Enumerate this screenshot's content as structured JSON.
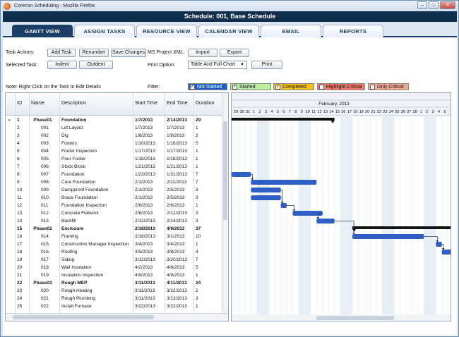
{
  "window": {
    "title": "Corecon Scheduling - Mozilla Firefox"
  },
  "header": {
    "title": "Schedule: 001, Base Schedule"
  },
  "tabs": [
    {
      "label": "Gantt View",
      "active": true
    },
    {
      "label": "Assign Tasks",
      "active": false
    },
    {
      "label": "Resource View",
      "active": false
    },
    {
      "label": "Calendar View",
      "active": false
    },
    {
      "label": "Email",
      "active": false
    },
    {
      "label": "Reports",
      "active": false
    }
  ],
  "controls": {
    "task_actions_label": "Task Actions:",
    "add_task": "Add Task",
    "renumber": "Renumber",
    "save_changes": "Save Changes",
    "ms_project_label": "MS Project XML:",
    "import": "Import",
    "export": "Export",
    "selected_task_label": "Selected Task:",
    "indent": "Indent",
    "outdent": "Outdent",
    "print_option_label": "Print Option:",
    "print_option_value": "Table And Full Chart",
    "print": "Print",
    "note": "Note: Right Click on the Task to Edit Details",
    "filter_label": "Filter:"
  },
  "filters": [
    {
      "label": "Not Started",
      "checked": true,
      "color": "#1f5fbf"
    },
    {
      "label": "Started",
      "checked": true,
      "color": "#b8f0a0"
    },
    {
      "label": "Completed",
      "checked": true,
      "color": "#f3c21b"
    },
    {
      "label": "Highlight Critical",
      "checked": false,
      "color": "#f07a6a"
    },
    {
      "label": "Only Critical",
      "checked": false,
      "color": "#f6a891"
    }
  ],
  "grid": {
    "columns": [
      "ID",
      "Name",
      "Description",
      "Start Time",
      "End Time",
      "Duration"
    ],
    "rows": [
      {
        "n": "1",
        "id": "Phase01",
        "desc": "Foundation",
        "start": "1/7/2013",
        "end": "2/14/2013",
        "dur": "29",
        "phase": true
      },
      {
        "n": "2",
        "id": "001",
        "desc": "Lot Layout",
        "start": "1/7/2013",
        "end": "1/7/2013",
        "dur": "1"
      },
      {
        "n": "3",
        "id": "002",
        "desc": "Dig",
        "start": "1/8/2013",
        "end": "1/9/2013",
        "dur": "2"
      },
      {
        "n": "4",
        "id": "003",
        "desc": "Footers",
        "start": "1/10/2013",
        "end": "1/16/2013",
        "dur": "5"
      },
      {
        "n": "5",
        "id": "004",
        "desc": "Footer Inspection",
        "start": "1/17/2013",
        "end": "1/17/2013",
        "dur": "1"
      },
      {
        "n": "6",
        "id": "005",
        "desc": "Pour Footer",
        "start": "1/18/2013",
        "end": "1/18/2013",
        "dur": "1"
      },
      {
        "n": "7",
        "id": "006",
        "desc": "Stock Block",
        "start": "1/21/2013",
        "end": "1/21/2013",
        "dur": "1"
      },
      {
        "n": "8",
        "id": "007",
        "desc": "Foundation",
        "start": "1/23/2013",
        "end": "1/31/2013",
        "dur": "7"
      },
      {
        "n": "9",
        "id": "008",
        "desc": "Cure Foundation",
        "start": "2/1/2013",
        "end": "2/11/2013",
        "dur": "7"
      },
      {
        "n": "10",
        "id": "009",
        "desc": "Dampproof Foundation",
        "start": "2/1/2013",
        "end": "2/5/2013",
        "dur": "3"
      },
      {
        "n": "11",
        "id": "010",
        "desc": "Brace Foundation",
        "start": "2/1/2013",
        "end": "2/5/2013",
        "dur": "3"
      },
      {
        "n": "12",
        "id": "011",
        "desc": "Foundation Inspection",
        "start": "2/6/2013",
        "end": "2/6/2013",
        "dur": "1"
      },
      {
        "n": "13",
        "id": "012",
        "desc": "Concrete Flatwork",
        "start": "2/8/2013",
        "end": "2/12/2013",
        "dur": "3"
      },
      {
        "n": "14",
        "id": "013",
        "desc": "Backfill",
        "start": "2/12/2013",
        "end": "2/14/2013",
        "dur": "3"
      },
      {
        "n": "15",
        "id": "Phase02",
        "desc": "Enclosure",
        "start": "2/18/2013",
        "end": "4/9/2013",
        "dur": "37",
        "phase": true
      },
      {
        "n": "16",
        "id": "014",
        "desc": "Framing",
        "start": "2/18/2013",
        "end": "3/1/2013",
        "dur": "10"
      },
      {
        "n": "17",
        "id": "015",
        "desc": "Construction Manager Inspection",
        "start": "3/4/2013",
        "end": "3/4/2013",
        "dur": "1"
      },
      {
        "n": "18",
        "id": "016",
        "desc": "Roofing",
        "start": "3/5/2013",
        "end": "3/8/2013",
        "dur": "4"
      },
      {
        "n": "19",
        "id": "017",
        "desc": "Siding",
        "start": "3/12/2013",
        "end": "3/20/2013",
        "dur": "7"
      },
      {
        "n": "20",
        "id": "018",
        "desc": "Wall Insulation",
        "start": "4/2/2013",
        "end": "4/8/2013",
        "dur": "5"
      },
      {
        "n": "21",
        "id": "019",
        "desc": "Insulation Inspection",
        "start": "4/9/2013",
        "end": "4/9/2013",
        "dur": "1"
      },
      {
        "n": "22",
        "id": "Phase03",
        "desc": "Rough MEP",
        "start": "3/11/2013",
        "end": "4/11/2013",
        "dur": "24",
        "phase": true
      },
      {
        "n": "23",
        "id": "020",
        "desc": "Rough Heating",
        "start": "3/11/2013",
        "end": "3/12/2013",
        "dur": "2"
      },
      {
        "n": "24",
        "id": "021",
        "desc": "Rough Plumbing",
        "start": "3/11/2013",
        "end": "3/13/2013",
        "dur": "3"
      },
      {
        "n": "25",
        "id": "022",
        "desc": "Install Furnace",
        "start": "3/22/2013",
        "end": "3/22/2013",
        "dur": "1"
      }
    ]
  },
  "gantt": {
    "month": "February, 2013",
    "days": [
      "29",
      "30",
      "31",
      "1",
      "2",
      "3",
      "4",
      "5",
      "6",
      "7",
      "8",
      "9",
      "10",
      "11",
      "12",
      "13",
      "14",
      "15",
      "16",
      "17",
      "18",
      "19",
      "20",
      "21",
      "22",
      "23",
      "24",
      "25",
      "26",
      "27",
      "28",
      "1",
      "2",
      "3",
      "4",
      "5"
    ],
    "bar_color": "#2f5fc4",
    "summary_color": "#111111",
    "tasks": [
      {
        "row": 0,
        "type": "summary",
        "start": "1/7/2013",
        "end": "2/14/2013"
      },
      {
        "row": 7,
        "type": "task",
        "start": "1/23/2013",
        "end": "1/31/2013"
      },
      {
        "row": 8,
        "type": "task",
        "start": "2/1/2013",
        "end": "2/11/2013"
      },
      {
        "row": 9,
        "type": "task",
        "start": "2/1/2013",
        "end": "2/5/2013"
      },
      {
        "row": 10,
        "type": "task",
        "start": "2/1/2013",
        "end": "2/5/2013"
      },
      {
        "row": 11,
        "type": "task",
        "start": "2/6/2013",
        "end": "2/6/2013"
      },
      {
        "row": 12,
        "type": "task",
        "start": "2/8/2013",
        "end": "2/12/2013"
      },
      {
        "row": 13,
        "type": "task",
        "start": "2/12/2013",
        "end": "2/14/2013"
      },
      {
        "row": 14,
        "type": "summary",
        "start": "2/18/2013",
        "end": "4/9/2013"
      },
      {
        "row": 15,
        "type": "task",
        "start": "2/18/2013",
        "end": "3/1/2013"
      },
      {
        "row": 16,
        "type": "task",
        "start": "3/4/2013",
        "end": "3/4/2013"
      },
      {
        "row": 17,
        "type": "task",
        "start": "3/5/2013",
        "end": "3/8/2013"
      }
    ]
  }
}
